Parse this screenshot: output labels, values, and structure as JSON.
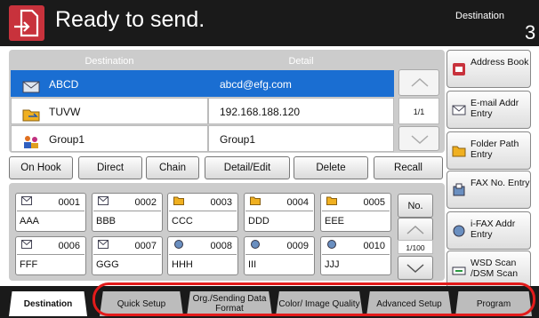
{
  "header": {
    "title": "Ready to send.",
    "destination_label": "Destination",
    "destination_count": "3",
    "icon": "send-document-icon",
    "accent": "#c8323c"
  },
  "dest_table": {
    "col_destination": "Destination",
    "col_detail": "Detail",
    "rows": [
      {
        "name": "ABCD",
        "detail": "abcd@efg.com",
        "icon": "email-icon",
        "selected": true
      },
      {
        "name": "TUVW",
        "detail": "192.168.188.120",
        "icon": "folder-icon",
        "selected": false
      },
      {
        "name": "Group1",
        "detail": "Group1",
        "icon": "group-icon",
        "selected": false
      }
    ],
    "page": "1/1"
  },
  "actions": {
    "on_hook": "On Hook",
    "direct": "Direct",
    "chain": "Chain",
    "detail_edit": "Detail/Edit",
    "delete": "Delete",
    "recall": "Recall"
  },
  "right_buttons": {
    "address_book": "Address Book",
    "email_entry": "E-mail Addr Entry",
    "folder_entry": "Folder Path Entry",
    "fax_entry": "FAX No. Entry",
    "ifax_entry": "i-FAX Addr Entry",
    "wsd_scan": "WSD Scan /DSM Scan"
  },
  "one_touch": {
    "keys": [
      {
        "num": "0001",
        "name": "AAA",
        "icon": "email-icon"
      },
      {
        "num": "0002",
        "name": "BBB",
        "icon": "email-icon"
      },
      {
        "num": "0003",
        "name": "CCC",
        "icon": "folder-icon"
      },
      {
        "num": "0004",
        "name": "DDD",
        "icon": "folder-icon"
      },
      {
        "num": "0005",
        "name": "EEE",
        "icon": "folder-icon"
      },
      {
        "num": "0006",
        "name": "FFF",
        "icon": "email-icon"
      },
      {
        "num": "0007",
        "name": "GGG",
        "icon": "email-icon"
      },
      {
        "num": "0008",
        "name": "HHH",
        "icon": "fax-icon"
      },
      {
        "num": "0009",
        "name": "III",
        "icon": "fax-icon"
      },
      {
        "num": "0010",
        "name": "JJJ",
        "icon": "fax-icon"
      }
    ],
    "no_label": "No.",
    "page": "1/100"
  },
  "tabs": {
    "destination": "Destination",
    "quick_setup": "Quick Setup",
    "org_sending": "Org./Sending Data Format",
    "color_quality": "Color/ Image Quality",
    "advanced": "Advanced Setup",
    "program": "Program"
  }
}
